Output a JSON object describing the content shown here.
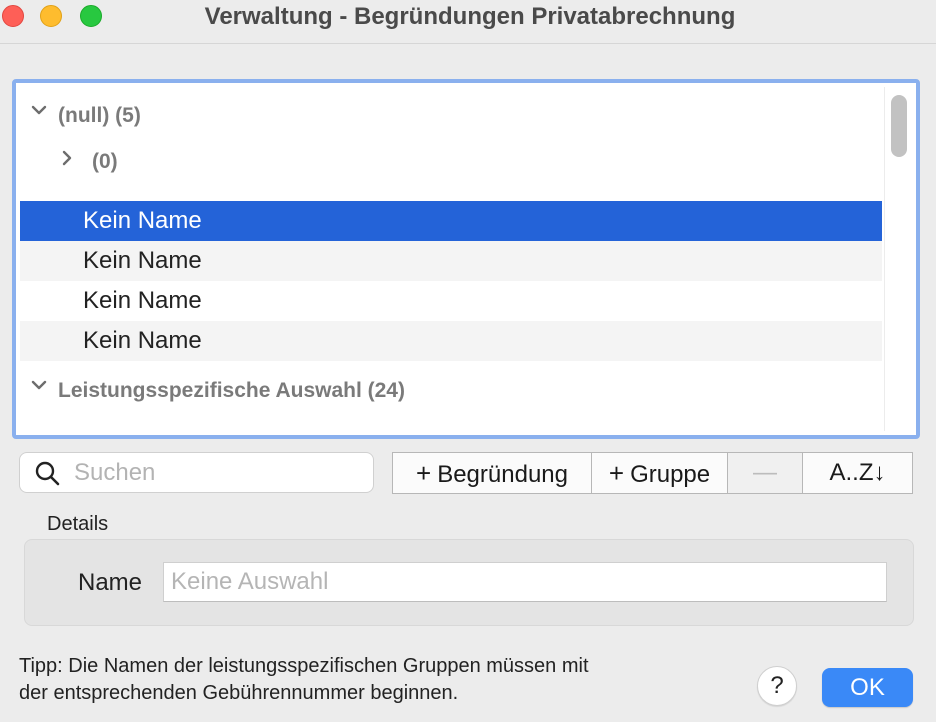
{
  "window": {
    "title": "Verwaltung - Begründungen Privatabrechnung"
  },
  "outline": {
    "group_null": {
      "label": "(null) (5)",
      "expanded": true
    },
    "subgroup_empty": {
      "label": "(0)",
      "expanded": false
    },
    "items": [
      {
        "label": "Kein Name",
        "selected": true
      },
      {
        "label": "Kein Name",
        "selected": false
      },
      {
        "label": "Kein Name",
        "selected": false
      },
      {
        "label": "Kein Name",
        "selected": false
      }
    ],
    "group_service": {
      "label": "Leistungsspezifische Auswahl (24)",
      "expanded": true
    }
  },
  "toolbar": {
    "search_placeholder": "Suchen",
    "add_reason_label": "Begründung",
    "add_group_label": "Gruppe",
    "remove_label": "—",
    "sort_label": "A..Z↓"
  },
  "details": {
    "section_label": "Details",
    "name_label": "Name",
    "name_placeholder": "Keine Auswahl",
    "name_value": ""
  },
  "footer": {
    "tip_line1": "Tipp: Die Namen der leistungsspezifischen Gruppen müssen mit",
    "tip_line2": "der entsprechenden Gebührennummer beginnen.",
    "help_label": "?",
    "ok_label": "OK"
  },
  "colors": {
    "accent": "#2463d8",
    "ok_button": "#3a89f7",
    "focus_ring": "#8ab0ee"
  },
  "icons": {
    "expanded": "chevron-down-icon",
    "collapsed": "chevron-right-icon",
    "search": "search-icon",
    "plus": "plus-icon"
  }
}
